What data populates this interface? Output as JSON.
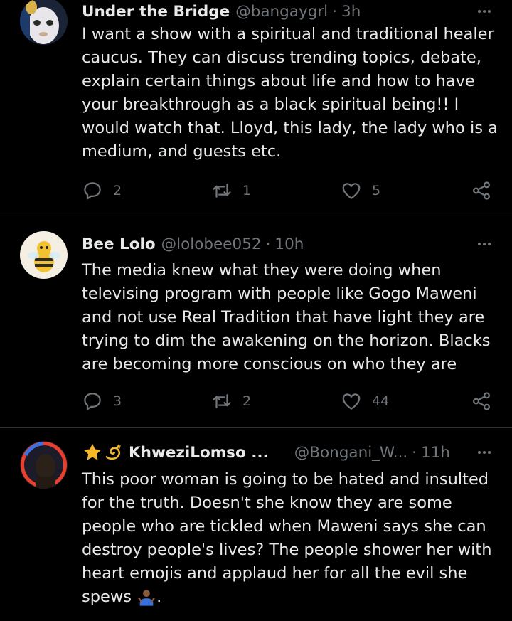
{
  "tweets": [
    {
      "name": "Under the Bridge",
      "handle": "@bangaygrl",
      "separator": "·",
      "time": "3h",
      "lines": [
        "I want a show with a spiritual and traditional healer",
        "caucus. They can discuss trending topics, debate,",
        "explain certain things about life and how to have",
        "your breakthrough as a black spiritual being!! I",
        "would watch that. Lloyd, this lady, the lady who is a",
        "medium, and guests etc."
      ],
      "replies": "2",
      "retweets": "1",
      "likes": "5",
      "icons": [
        "reply-icon",
        "retweet-icon",
        "like-icon",
        "share-icon",
        "more-icon"
      ]
    },
    {
      "name": "Bee Lolo",
      "handle": "@lolobee052",
      "separator": "·",
      "time": "10h",
      "lines": [
        "The media knew what they were doing when",
        "televising program with people like Gogo Maweni",
        "and not use Real Tradition that have light they are",
        "trying to dim the awakening on the horizon. Blacks",
        "are becoming more conscious on who they are"
      ],
      "replies": "3",
      "retweets": "2",
      "likes": "44"
    },
    {
      "name": "KhweziLomso ...",
      "name_emojis": [
        "star-emoji",
        "dizzy-emoji"
      ],
      "handle": "@Bongani_W...",
      "separator": "·",
      "time": "11h",
      "lines": [
        "This poor woman is going to be hated and insulted",
        "for the truth. Doesn't she know they are some",
        "people who are tickled when Maweni says she can",
        "destroy people's lives? The people shower her with",
        "heart emojis and applaud her for all the evil she",
        "spews"
      ],
      "end_emoji": "person-shrugging-emoji",
      "end_text": "."
    }
  ],
  "colors": {
    "background": "#000000",
    "text": "#e7e9ea",
    "muted": "#71767b",
    "divider": "#2f3336"
  }
}
